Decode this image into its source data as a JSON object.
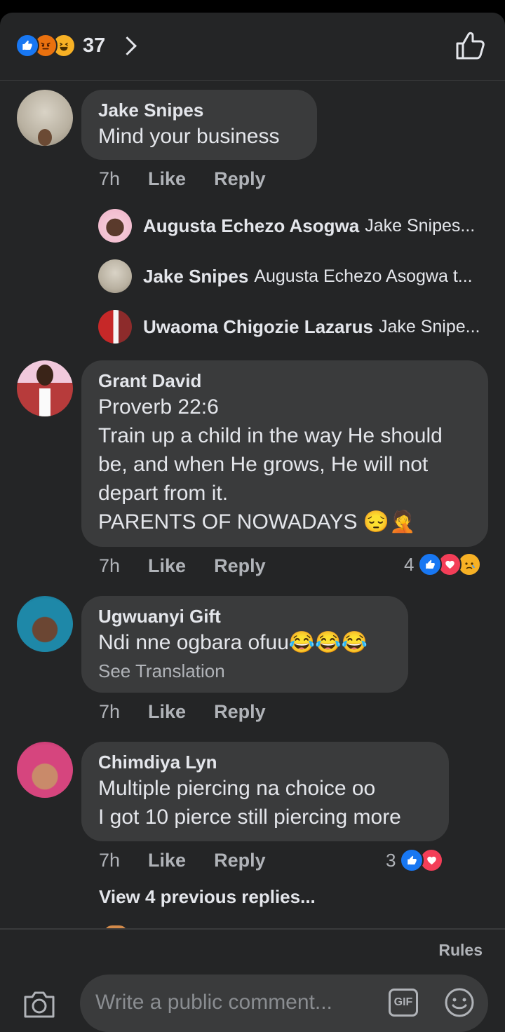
{
  "header": {
    "reaction_icons": [
      "like-icon",
      "angry-icon",
      "haha-icon"
    ],
    "reaction_count": "37"
  },
  "comments": [
    {
      "author": "Jake Snipes",
      "text": "Mind your business",
      "time": "7h",
      "like_label": "Like",
      "reply_label": "Reply",
      "replies": [
        {
          "author": "Augusta Echezo Asogwa",
          "text": "Jake Snipes..."
        },
        {
          "author": "Jake Snipes",
          "text": "Augusta Echezo Asogwa t..."
        },
        {
          "author": "Uwaoma Chigozie Lazarus",
          "text": "Jake Snipe..."
        }
      ]
    },
    {
      "author": "Grant David",
      "text": "Proverb 22:6\nTrain up a child in the way He should be, and when He grows, He will not depart from it.\nPARENTS OF NOWADAYS 😔🤦",
      "time": "7h",
      "like_label": "Like",
      "reply_label": "Reply",
      "reaction_count": "4",
      "reactions": [
        "like-icon",
        "love-icon",
        "sad-icon"
      ]
    },
    {
      "author": "Ugwuanyi Gift",
      "text": "Ndi nne ogbara ofuu😂😂😂",
      "translate_label": "See Translation",
      "time": "7h",
      "like_label": "Like",
      "reply_label": "Reply"
    },
    {
      "author": "Chimdiya Lyn",
      "text": "Multiple piercing na choice oo\nI got 10 pierce still piercing more",
      "time": "7h",
      "like_label": "Like",
      "reply_label": "Reply",
      "reaction_count": "3",
      "reactions": [
        "like-icon",
        "love-icon"
      ],
      "view_previous_label": "View 4 previous replies..."
    }
  ],
  "composer": {
    "rules_label": "Rules",
    "placeholder": "Write a public comment...",
    "gif_label": "GIF"
  },
  "colors": {
    "background": "#242526",
    "bubble": "#3a3b3c",
    "like_blue": "#1877f2",
    "love_red": "#f33e58"
  }
}
